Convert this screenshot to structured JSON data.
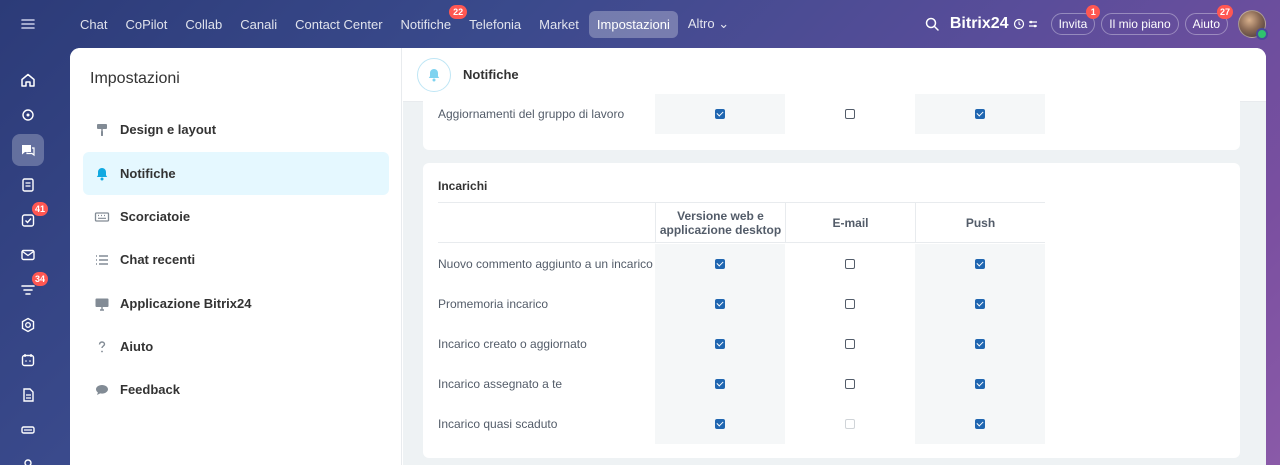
{
  "topnav": {
    "items": [
      {
        "label": "Chat"
      },
      {
        "label": "CoPilot"
      },
      {
        "label": "Collab"
      },
      {
        "label": "Canali"
      },
      {
        "label": "Contact Center"
      },
      {
        "label": "Notifiche",
        "badge": "22"
      },
      {
        "label": "Telefonia"
      },
      {
        "label": "Market"
      },
      {
        "label": "Impostazioni",
        "active": true
      },
      {
        "label": "Altro ⌄"
      }
    ],
    "brand": "Bitrix24",
    "invite_label": "Invita",
    "invite_badge": "1",
    "plan_label": "Il mio piano",
    "help_label": "Aiuto",
    "help_badge": "27"
  },
  "rail": {
    "badges": {
      "tasks": "41",
      "feed": "34"
    }
  },
  "sidebar": {
    "title": "Impostazioni",
    "items": [
      {
        "label": "Design e layout",
        "icon": "paint-roller-icon"
      },
      {
        "label": "Notifiche",
        "icon": "bell-icon",
        "active": true
      },
      {
        "label": "Scorciatoie",
        "icon": "keyboard-icon"
      },
      {
        "label": "Chat recenti",
        "icon": "list-icon"
      },
      {
        "label": "Applicazione Bitrix24",
        "icon": "monitor-icon"
      },
      {
        "label": "Aiuto",
        "icon": "question-icon"
      },
      {
        "label": "Feedback",
        "icon": "speech-bubble-icon"
      }
    ]
  },
  "header": {
    "title": "Notifiche"
  },
  "workgroup": {
    "label": "Aggiornamenti del gruppo di lavoro",
    "web": true,
    "email": false,
    "push": true
  },
  "tasks": {
    "title": "Incarichi",
    "columns": {
      "web": "Versione web e applicazione desktop",
      "email": "E-mail",
      "push": "Push"
    },
    "rows": [
      {
        "label": "Nuovo commento aggiunto a un incarico",
        "web": true,
        "email": false,
        "push": true
      },
      {
        "label": "Promemoria incarico",
        "web": true,
        "email": false,
        "push": true
      },
      {
        "label": "Incarico creato o aggiornato",
        "web": true,
        "email": false,
        "push": true
      },
      {
        "label": "Incarico assegnato a te",
        "web": true,
        "email": false,
        "push": true
      },
      {
        "label": "Incarico quasi scaduto",
        "web": true,
        "email": "disabled",
        "push": true
      }
    ]
  },
  "colors": {
    "accent": "#2066b0",
    "badge": "#ff5752",
    "active_bg": "#e5f8ff"
  }
}
